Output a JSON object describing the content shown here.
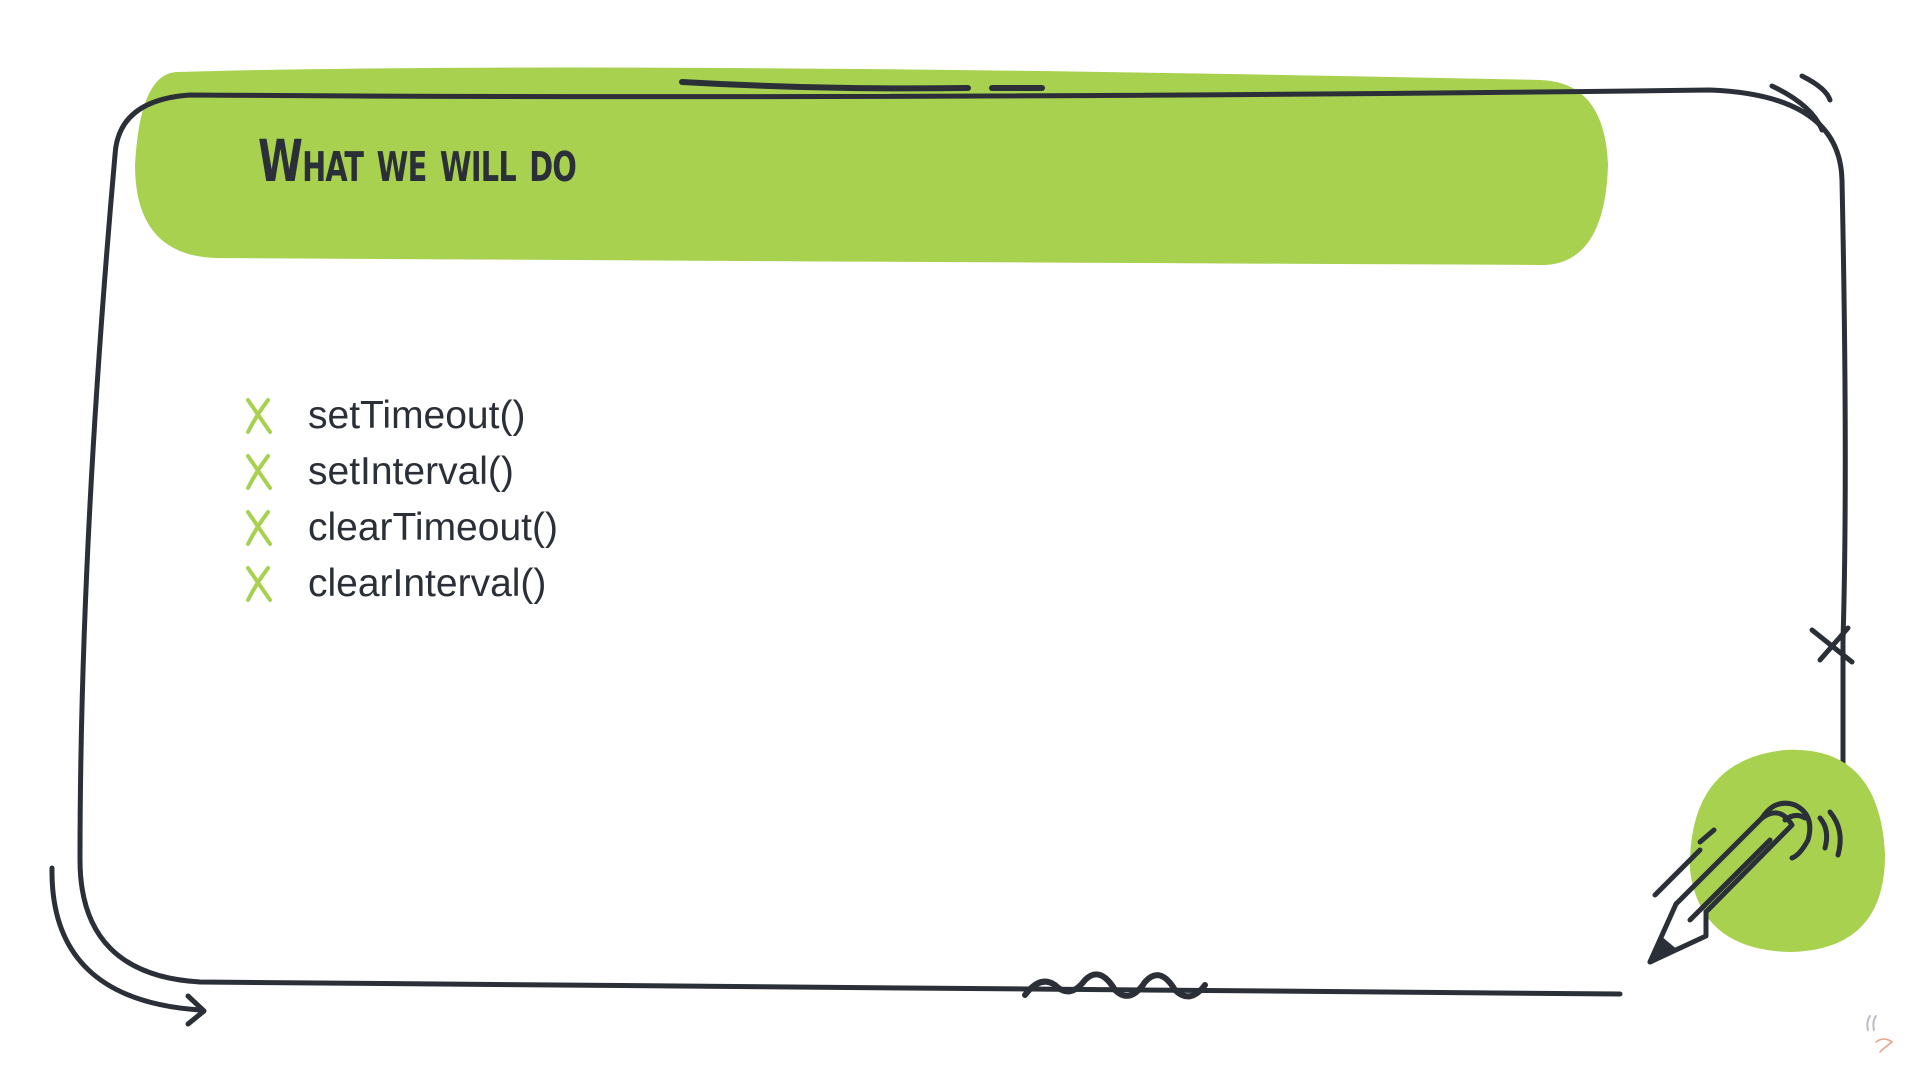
{
  "slide": {
    "title": "What we will do",
    "items": [
      {
        "label": "setTimeout()"
      },
      {
        "label": "setInterval()"
      },
      {
        "label": "clearTimeout()"
      },
      {
        "label": "clearInterval()"
      }
    ]
  },
  "theme": {
    "accent_green": "#a8d14f",
    "ink": "#2b3038",
    "background": "#ffffff"
  },
  "icons": {
    "bullet": "x-mark-icon",
    "decoration": "pencil-icon"
  }
}
